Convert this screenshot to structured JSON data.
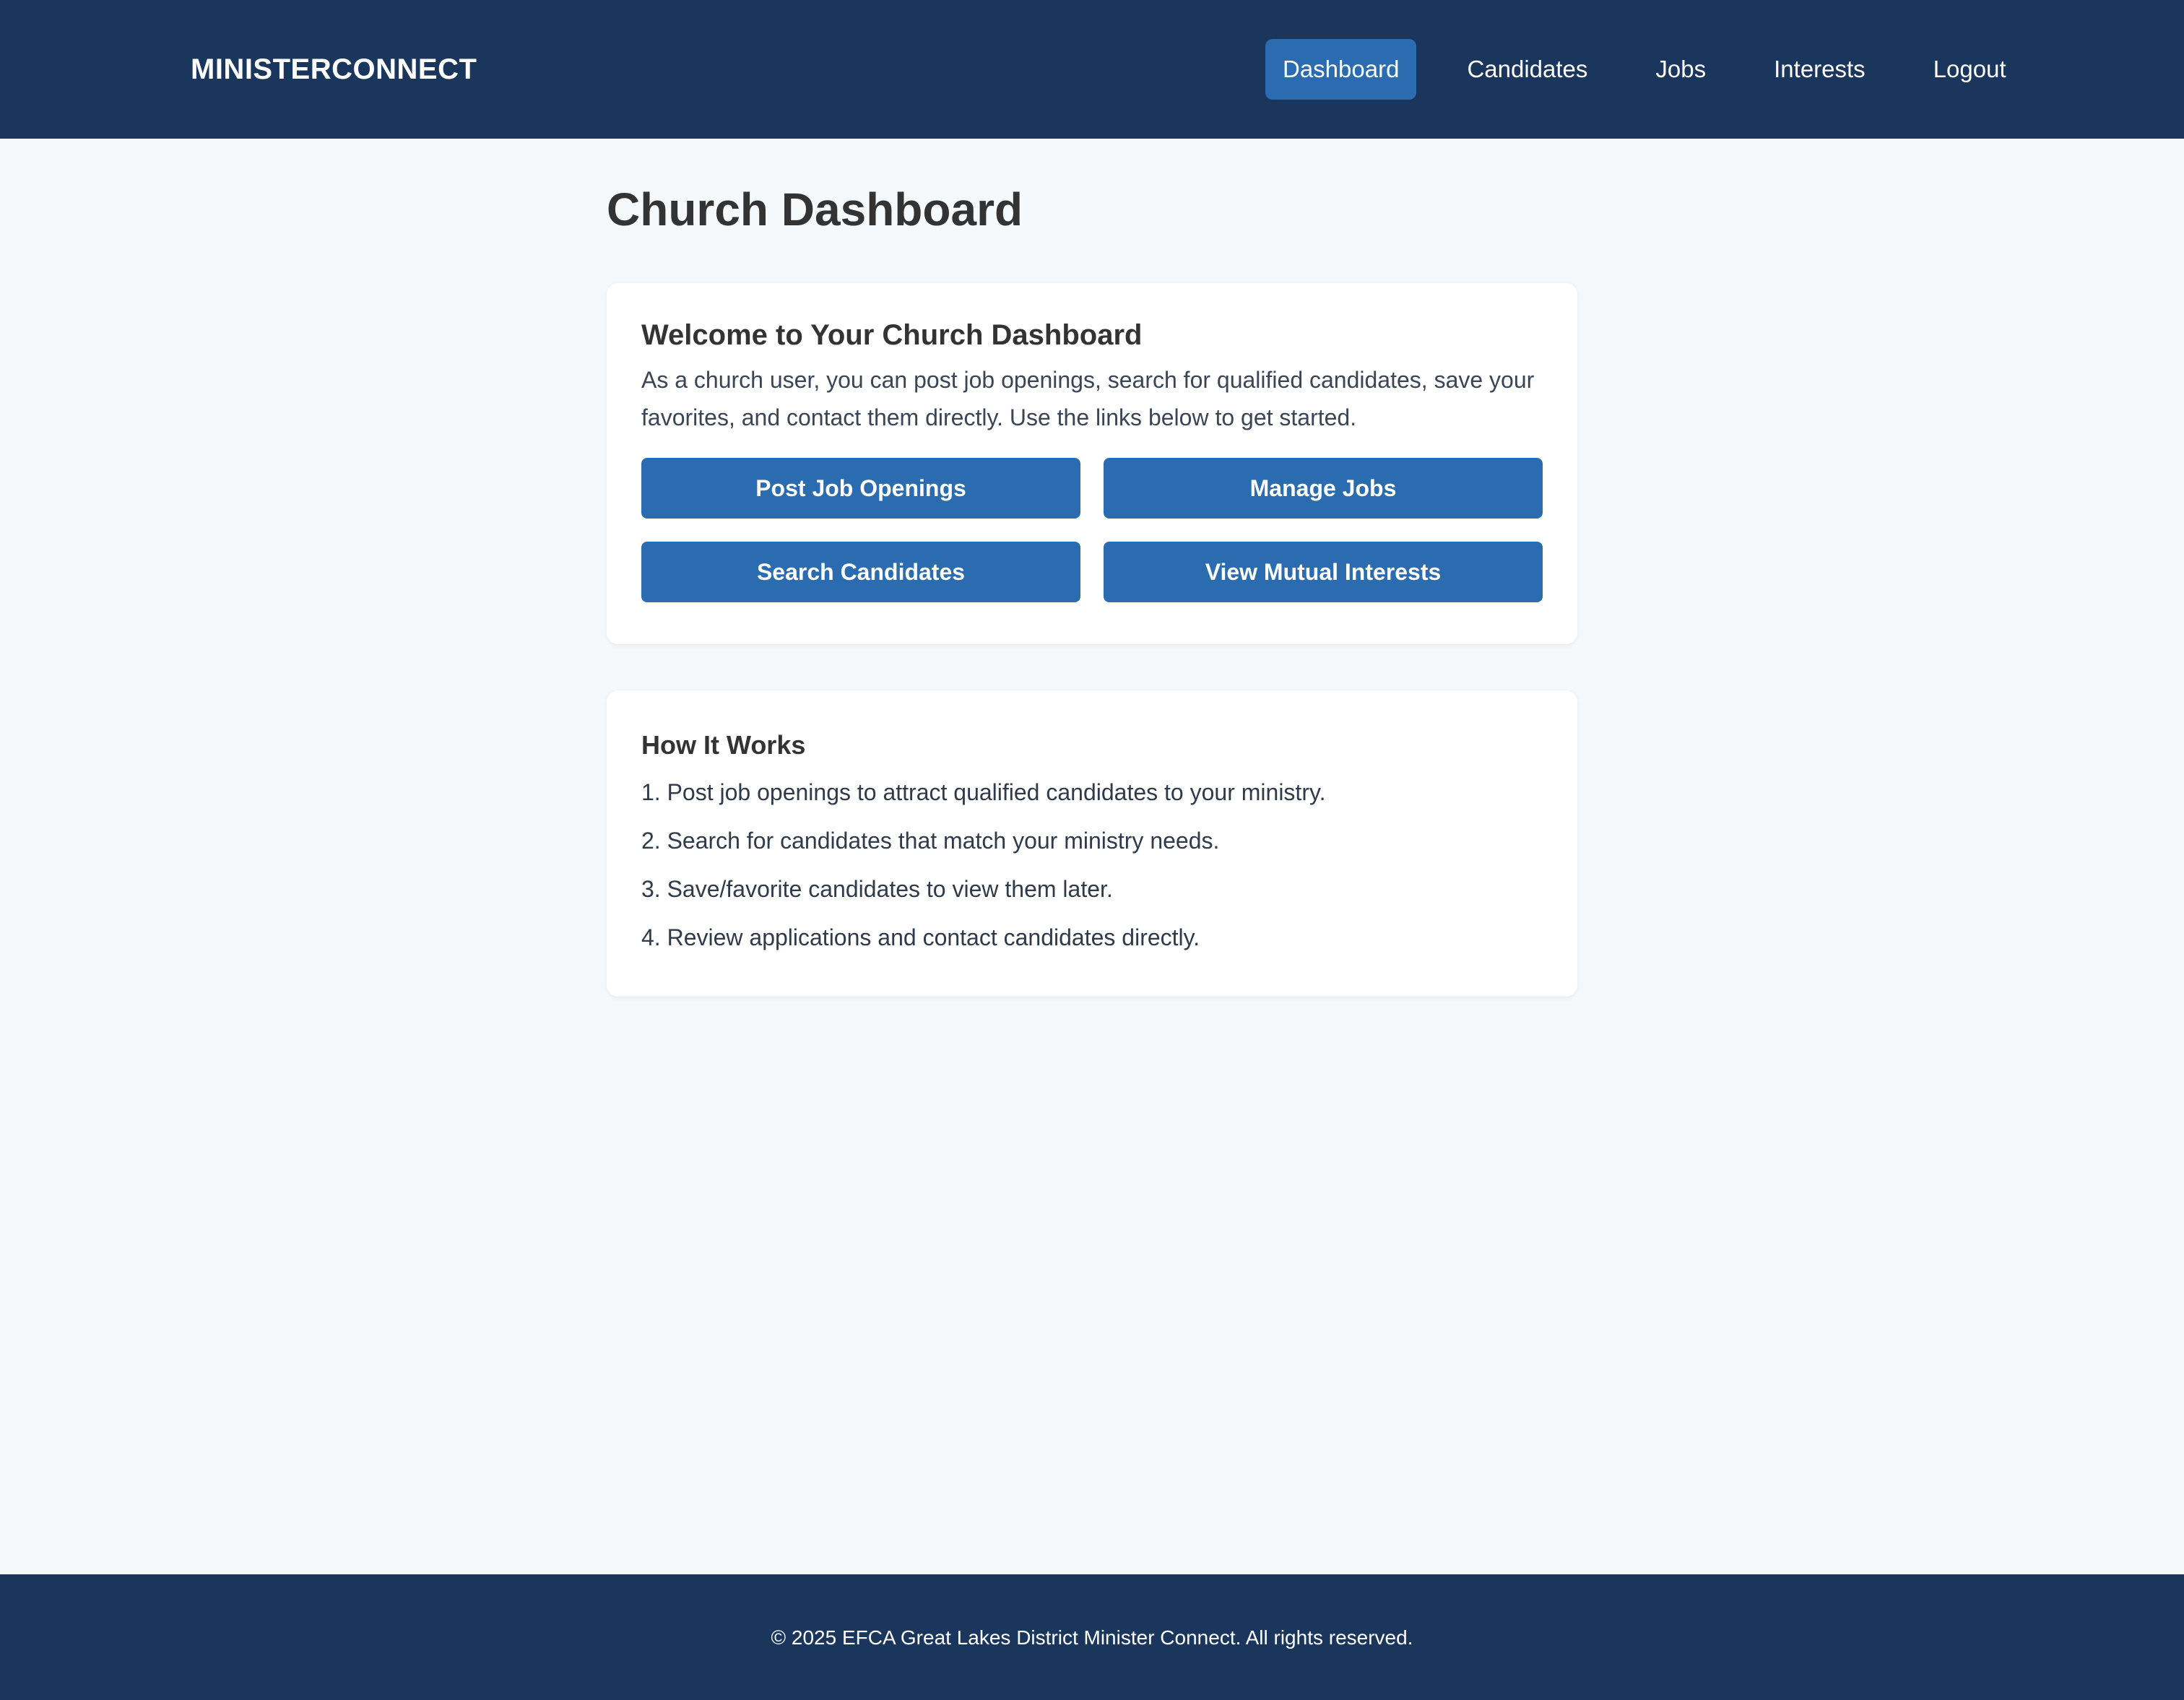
{
  "header": {
    "brand": "MINISTERCONNECT",
    "nav": [
      {
        "label": "Dashboard",
        "active": true
      },
      {
        "label": "Candidates",
        "active": false
      },
      {
        "label": "Jobs",
        "active": false
      },
      {
        "label": "Interests",
        "active": false
      },
      {
        "label": "Logout",
        "active": false
      }
    ]
  },
  "main": {
    "page_title": "Church Dashboard",
    "welcome": {
      "title": "Welcome to Your Church Dashboard",
      "text": "As a church user, you can post job openings, search for qualified candidates, save your favorites, and contact them directly. Use the links below to get started.",
      "buttons": [
        {
          "label": "Post Job Openings"
        },
        {
          "label": "Manage Jobs"
        },
        {
          "label": "Search Candidates"
        },
        {
          "label": "View Mutual Interests"
        }
      ]
    },
    "how_it_works": {
      "title": "How It Works",
      "steps": [
        "1. Post job openings to attract qualified candidates to your ministry.",
        "2. Search for candidates that match your ministry needs.",
        "3. Save/favorite candidates to view them later.",
        "4. Review applications and contact candidates directly."
      ]
    }
  },
  "footer": {
    "text": "© 2025 EFCA Great Lakes District Minister Connect. All rights reserved."
  },
  "colors": {
    "header_bg": "#1b365d",
    "accent": "#2b6cb0",
    "page_bg": "#f5f9fc",
    "card_bg": "#ffffff",
    "heading_text": "#333333"
  }
}
